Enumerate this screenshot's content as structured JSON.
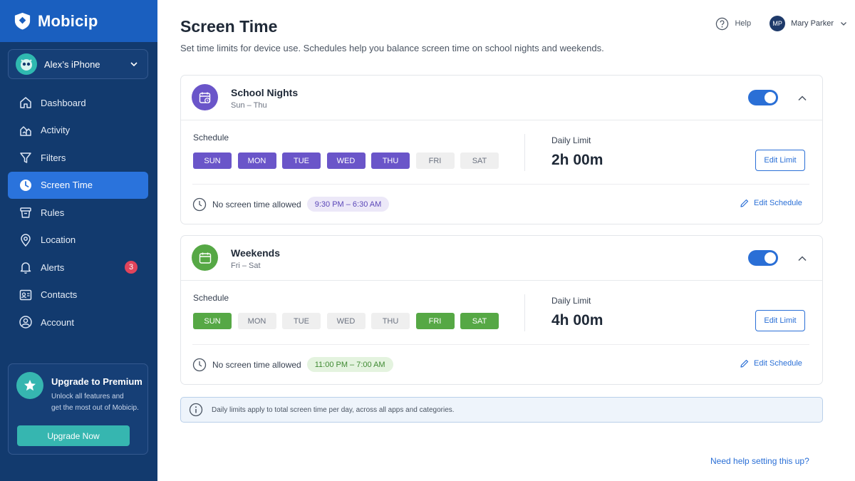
{
  "brand": {
    "name": "Mobicip"
  },
  "device": {
    "name": "Alex’s iPhone"
  },
  "nav": [
    {
      "label": "Dashboard",
      "icon": "home-icon"
    },
    {
      "label": "Activity",
      "icon": "activity-icon"
    },
    {
      "label": "Filters",
      "icon": "filter-icon"
    },
    {
      "label": "Screen Time",
      "icon": "clock-icon",
      "active": true
    },
    {
      "label": "Rules",
      "icon": "rules-icon"
    },
    {
      "label": "Location",
      "icon": "location-pin-icon"
    },
    {
      "label": "Alerts",
      "icon": "bell-icon",
      "badge": "3"
    },
    {
      "label": "Contacts",
      "icon": "contacts-icon"
    },
    {
      "label": "Account",
      "icon": "account-icon"
    }
  ],
  "premium": {
    "title": "Upgrade to Premium",
    "desc_line1": "Unlock all features and",
    "desc_line2": "get the most out of Mobicip.",
    "button": "Upgrade Now"
  },
  "header": {
    "title": "Screen Time",
    "subtitle": "Set time limits for device use. Schedules help you balance screen time on school nights and weekends.",
    "help": "Help",
    "user_initials": "MP",
    "user_name": "Mary Parker"
  },
  "cards": [
    {
      "title": "School Nights",
      "subtitle": "Sun – Thu",
      "enabled": true,
      "accent": "#6a55c9",
      "schedule_label": "Schedule",
      "days": [
        {
          "label": "SUN",
          "on": true
        },
        {
          "label": "MON",
          "on": true
        },
        {
          "label": "TUE",
          "on": true
        },
        {
          "label": "WED",
          "on": true
        },
        {
          "label": "THU",
          "on": true
        },
        {
          "label": "FRI",
          "on": false
        },
        {
          "label": "SAT",
          "on": false
        }
      ],
      "limit_label": "Daily Limit",
      "limit_value": "2h 00m",
      "edit_limit": "Edit Limit",
      "no_screen_label": "No screen time allowed",
      "no_screen_range": "9:30 PM – 6:30 AM",
      "edit_schedule": "Edit Schedule"
    },
    {
      "title": "Weekends",
      "subtitle": "Fri – Sat",
      "enabled": true,
      "accent": "#56a845",
      "schedule_label": "Schedule",
      "days": [
        {
          "label": "SUN",
          "on": true
        },
        {
          "label": "MON",
          "on": false
        },
        {
          "label": "TUE",
          "on": false
        },
        {
          "label": "WED",
          "on": false
        },
        {
          "label": "THU",
          "on": false
        },
        {
          "label": "FRI",
          "on": true
        },
        {
          "label": "SAT",
          "on": true
        }
      ],
      "limit_label": "Daily Limit",
      "limit_value": "4h 00m",
      "edit_limit": "Edit Limit",
      "no_screen_label": "No screen time allowed",
      "no_screen_range": "11:00 PM – 7:00 AM",
      "edit_schedule": "Edit Schedule"
    }
  ],
  "info": {
    "text": "Daily limits apply to total screen time per day, across all apps and categories."
  },
  "help_link": "Need help setting this up?",
  "colors": {
    "sidebar": "#123a6e",
    "brand_bar": "#1a5fbf",
    "active_nav": "#2a73dc",
    "primary": "#2a6fd6",
    "teal": "#36b6b0",
    "badge": "#e0445b"
  }
}
